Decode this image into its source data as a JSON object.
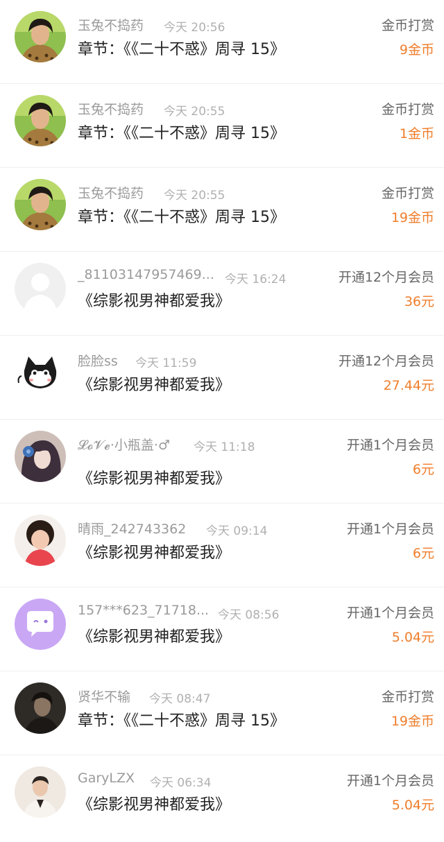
{
  "accent_color": "#f07d2a",
  "records": [
    {
      "avatar": "avatar-photo-man-leopard",
      "name": "玉兔不捣药",
      "time": "今天 20:56",
      "title": "章节：《《二十不惑》周寻 15》",
      "type": "金币打赏",
      "amount": "9金币"
    },
    {
      "avatar": "avatar-photo-man-leopard",
      "name": "玉兔不捣药",
      "time": "今天 20:55",
      "title": "章节：《《二十不惑》周寻 15》",
      "type": "金币打赏",
      "amount": "1金币"
    },
    {
      "avatar": "avatar-photo-man-leopard",
      "name": "玉兔不捣药",
      "time": "今天 20:55",
      "title": "章节：《《二十不惑》周寻 15》",
      "type": "金币打赏",
      "amount": "19金币"
    },
    {
      "avatar": "avatar-default-silhouette",
      "name": "_81103147957469...",
      "time": "今天 16:24",
      "title": "《综影视男神都爱我》",
      "type": "开通12个月会员",
      "amount": "36元"
    },
    {
      "avatar": "avatar-cartoon-cat",
      "name": "脸脸ss",
      "time": "今天 11:59",
      "title": "《综影视男神都爱我》",
      "type": "开通12个月会员",
      "amount": "27.44元"
    },
    {
      "avatar": "avatar-anime-girl",
      "name": "𝓛𝓸𝓥𝓮·小瓶盖·♂",
      "time": "今天 11:18",
      "title": "《综影视男神都爱我》",
      "type": "开通1个月会员",
      "amount": "6元"
    },
    {
      "avatar": "avatar-photo-little-girl",
      "name": "晴雨_242743362",
      "time": "今天 09:14",
      "title": "《综影视男神都爱我》",
      "type": "开通1个月会员",
      "amount": "6元"
    },
    {
      "avatar": "avatar-chat-bubble",
      "name": "157***623_71718...",
      "time": "今天 08:56",
      "title": "《综影视男神都爱我》",
      "type": "开通1个月会员",
      "amount": "5.04元"
    },
    {
      "avatar": "avatar-photo-dark-portrait",
      "name": "贤华不输",
      "time": "今天 08:47",
      "title": "章节：《《二十不惑》周寻 15》",
      "type": "金币打赏",
      "amount": "19金币"
    },
    {
      "avatar": "avatar-photo-man-suit",
      "name": "GaryLZX",
      "time": "今天 06:34",
      "title": "《综影视男神都爱我》",
      "type": "开通1个月会员",
      "amount": "5.04元"
    }
  ]
}
